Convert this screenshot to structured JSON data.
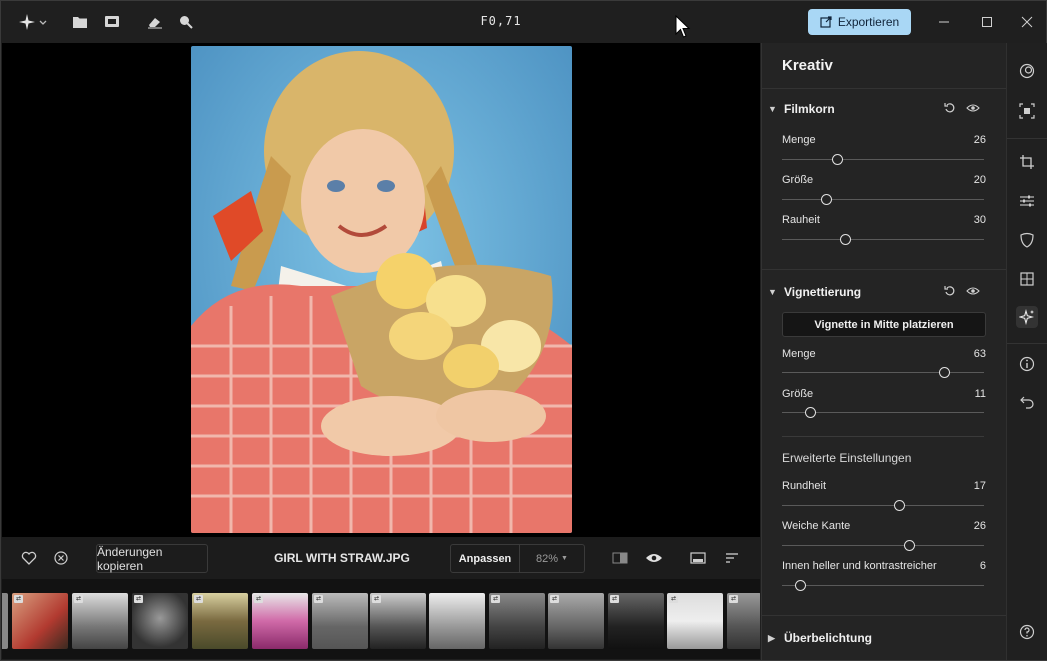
{
  "titlebar": {
    "title": "F0,71",
    "export_label": "Exportieren",
    "icons": [
      "sparkle-menu-icon",
      "folder-icon",
      "import-icon",
      "eraser-icon",
      "zoom-icon"
    ]
  },
  "bottom": {
    "copy_label": "Änderungen kopieren",
    "filename": "GIRL WITH STRAW.JPG",
    "fit_label": "Anpassen",
    "zoom_label": "82%"
  },
  "panel": {
    "title": "Kreativ",
    "filmkorn": {
      "label": "Filmkorn",
      "sliders": [
        {
          "label": "Menge",
          "value": "26",
          "pos": 0.27
        },
        {
          "label": "Größe",
          "value": "20",
          "pos": 0.22
        },
        {
          "label": "Rauheit",
          "value": "30",
          "pos": 0.31
        }
      ]
    },
    "vignette": {
      "label": "Vignettierung",
      "center_button": "Vignette in Mitte platzieren",
      "sliders": [
        {
          "label": "Menge",
          "value": "63",
          "pos": 0.8
        },
        {
          "label": "Größe",
          "value": "11",
          "pos": 0.14
        }
      ],
      "advanced_label": "Erweiterte Einstellungen",
      "advanced": [
        {
          "label": "Rundheit",
          "value": "17",
          "pos": 0.58
        },
        {
          "label": "Weiche Kante",
          "value": "26",
          "pos": 0.63
        },
        {
          "label": "Innen heller und kontrastreicher",
          "value": "6",
          "pos": 0.09
        }
      ]
    },
    "overexposure_label": "Überbelichtung"
  },
  "colors": {
    "accent": "#a9d7f5",
    "background": "#1f1f1f",
    "panel": "#242424"
  }
}
